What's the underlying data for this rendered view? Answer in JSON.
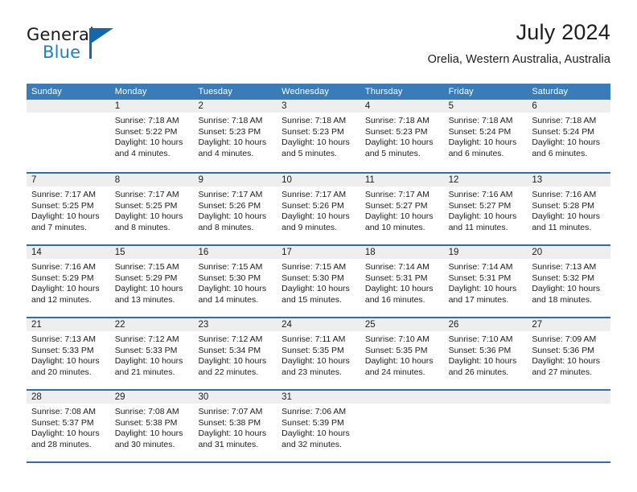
{
  "brand": {
    "name_top": "General",
    "name_bottom": "Blue",
    "triangle_icon": "triangle-logo-icon",
    "color_dark": "#1a1a1a",
    "color_blue": "#1f7fc4"
  },
  "header": {
    "title": "July 2024",
    "subtitle": "Orelia, Western Australia, Australia"
  },
  "colors": {
    "header_blue": "#3a7cb8",
    "rule_blue": "#2f6fa8",
    "day_band_gray": "#eeeeee",
    "text": "#1c1c1c"
  },
  "calendar": {
    "weekday_headers": [
      "Sunday",
      "Monday",
      "Tuesday",
      "Wednesday",
      "Thursday",
      "Friday",
      "Saturday"
    ],
    "weeks": [
      [
        {
          "day": "",
          "lines": []
        },
        {
          "day": "1",
          "lines": [
            "Sunrise: 7:18 AM",
            "Sunset: 5:22 PM",
            "Daylight: 10 hours",
            "and 4 minutes."
          ]
        },
        {
          "day": "2",
          "lines": [
            "Sunrise: 7:18 AM",
            "Sunset: 5:23 PM",
            "Daylight: 10 hours",
            "and 4 minutes."
          ]
        },
        {
          "day": "3",
          "lines": [
            "Sunrise: 7:18 AM",
            "Sunset: 5:23 PM",
            "Daylight: 10 hours",
            "and 5 minutes."
          ]
        },
        {
          "day": "4",
          "lines": [
            "Sunrise: 7:18 AM",
            "Sunset: 5:23 PM",
            "Daylight: 10 hours",
            "and 5 minutes."
          ]
        },
        {
          "day": "5",
          "lines": [
            "Sunrise: 7:18 AM",
            "Sunset: 5:24 PM",
            "Daylight: 10 hours",
            "and 6 minutes."
          ]
        },
        {
          "day": "6",
          "lines": [
            "Sunrise: 7:18 AM",
            "Sunset: 5:24 PM",
            "Daylight: 10 hours",
            "and 6 minutes."
          ]
        }
      ],
      [
        {
          "day": "7",
          "lines": [
            "Sunrise: 7:17 AM",
            "Sunset: 5:25 PM",
            "Daylight: 10 hours",
            "and 7 minutes."
          ]
        },
        {
          "day": "8",
          "lines": [
            "Sunrise: 7:17 AM",
            "Sunset: 5:25 PM",
            "Daylight: 10 hours",
            "and 8 minutes."
          ]
        },
        {
          "day": "9",
          "lines": [
            "Sunrise: 7:17 AM",
            "Sunset: 5:26 PM",
            "Daylight: 10 hours",
            "and 8 minutes."
          ]
        },
        {
          "day": "10",
          "lines": [
            "Sunrise: 7:17 AM",
            "Sunset: 5:26 PM",
            "Daylight: 10 hours",
            "and 9 minutes."
          ]
        },
        {
          "day": "11",
          "lines": [
            "Sunrise: 7:17 AM",
            "Sunset: 5:27 PM",
            "Daylight: 10 hours",
            "and 10 minutes."
          ]
        },
        {
          "day": "12",
          "lines": [
            "Sunrise: 7:16 AM",
            "Sunset: 5:27 PM",
            "Daylight: 10 hours",
            "and 11 minutes."
          ]
        },
        {
          "day": "13",
          "lines": [
            "Sunrise: 7:16 AM",
            "Sunset: 5:28 PM",
            "Daylight: 10 hours",
            "and 11 minutes."
          ]
        }
      ],
      [
        {
          "day": "14",
          "lines": [
            "Sunrise: 7:16 AM",
            "Sunset: 5:29 PM",
            "Daylight: 10 hours",
            "and 12 minutes."
          ]
        },
        {
          "day": "15",
          "lines": [
            "Sunrise: 7:15 AM",
            "Sunset: 5:29 PM",
            "Daylight: 10 hours",
            "and 13 minutes."
          ]
        },
        {
          "day": "16",
          "lines": [
            "Sunrise: 7:15 AM",
            "Sunset: 5:30 PM",
            "Daylight: 10 hours",
            "and 14 minutes."
          ]
        },
        {
          "day": "17",
          "lines": [
            "Sunrise: 7:15 AM",
            "Sunset: 5:30 PM",
            "Daylight: 10 hours",
            "and 15 minutes."
          ]
        },
        {
          "day": "18",
          "lines": [
            "Sunrise: 7:14 AM",
            "Sunset: 5:31 PM",
            "Daylight: 10 hours",
            "and 16 minutes."
          ]
        },
        {
          "day": "19",
          "lines": [
            "Sunrise: 7:14 AM",
            "Sunset: 5:31 PM",
            "Daylight: 10 hours",
            "and 17 minutes."
          ]
        },
        {
          "day": "20",
          "lines": [
            "Sunrise: 7:13 AM",
            "Sunset: 5:32 PM",
            "Daylight: 10 hours",
            "and 18 minutes."
          ]
        }
      ],
      [
        {
          "day": "21",
          "lines": [
            "Sunrise: 7:13 AM",
            "Sunset: 5:33 PM",
            "Daylight: 10 hours",
            "and 20 minutes."
          ]
        },
        {
          "day": "22",
          "lines": [
            "Sunrise: 7:12 AM",
            "Sunset: 5:33 PM",
            "Daylight: 10 hours",
            "and 21 minutes."
          ]
        },
        {
          "day": "23",
          "lines": [
            "Sunrise: 7:12 AM",
            "Sunset: 5:34 PM",
            "Daylight: 10 hours",
            "and 22 minutes."
          ]
        },
        {
          "day": "24",
          "lines": [
            "Sunrise: 7:11 AM",
            "Sunset: 5:35 PM",
            "Daylight: 10 hours",
            "and 23 minutes."
          ]
        },
        {
          "day": "25",
          "lines": [
            "Sunrise: 7:10 AM",
            "Sunset: 5:35 PM",
            "Daylight: 10 hours",
            "and 24 minutes."
          ]
        },
        {
          "day": "26",
          "lines": [
            "Sunrise: 7:10 AM",
            "Sunset: 5:36 PM",
            "Daylight: 10 hours",
            "and 26 minutes."
          ]
        },
        {
          "day": "27",
          "lines": [
            "Sunrise: 7:09 AM",
            "Sunset: 5:36 PM",
            "Daylight: 10 hours",
            "and 27 minutes."
          ]
        }
      ],
      [
        {
          "day": "28",
          "lines": [
            "Sunrise: 7:08 AM",
            "Sunset: 5:37 PM",
            "Daylight: 10 hours",
            "and 28 minutes."
          ]
        },
        {
          "day": "29",
          "lines": [
            "Sunrise: 7:08 AM",
            "Sunset: 5:38 PM",
            "Daylight: 10 hours",
            "and 30 minutes."
          ]
        },
        {
          "day": "30",
          "lines": [
            "Sunrise: 7:07 AM",
            "Sunset: 5:38 PM",
            "Daylight: 10 hours",
            "and 31 minutes."
          ]
        },
        {
          "day": "31",
          "lines": [
            "Sunrise: 7:06 AM",
            "Sunset: 5:39 PM",
            "Daylight: 10 hours",
            "and 32 minutes."
          ]
        },
        {
          "day": "",
          "lines": []
        },
        {
          "day": "",
          "lines": []
        },
        {
          "day": "",
          "lines": []
        }
      ]
    ]
  }
}
